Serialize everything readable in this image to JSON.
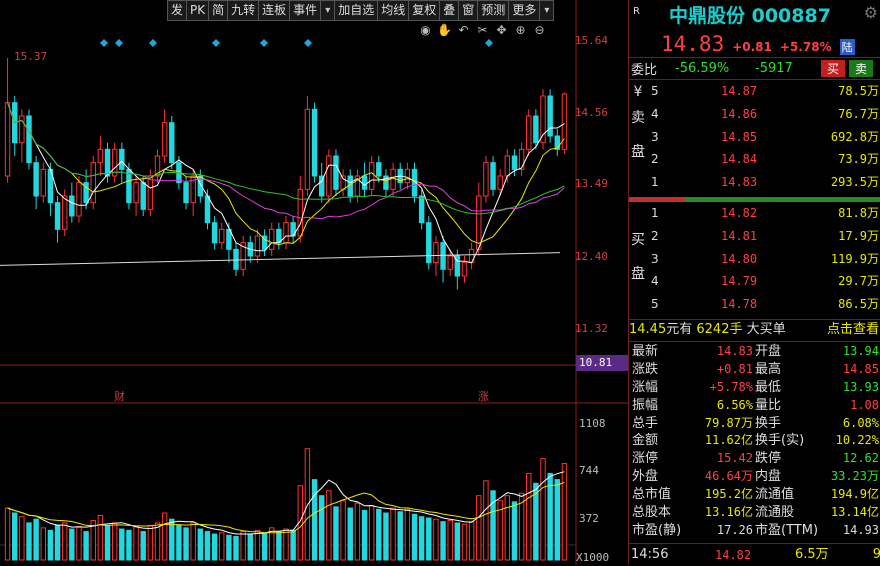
{
  "toolbar": [
    "发",
    "PK",
    "简",
    "九转",
    "连板",
    "事件",
    "▾",
    "加自选",
    "均线",
    "复权",
    "叠",
    "窗",
    "预测",
    "更多",
    "▾"
  ],
  "chart": {
    "high_marker": "15.37",
    "price_axis": [
      "15.64",
      "14.56",
      "13.49",
      "12.40",
      "11.32"
    ],
    "current_price_tag": "10.81",
    "volume_axis": [
      "1108",
      "744",
      "372"
    ],
    "volume_unit": "X1000",
    "event_labels": [
      "财",
      "涨"
    ],
    "colors": {
      "up": "#ff3232",
      "down": "#22d8e0",
      "ma5": "#ffffff",
      "ma10": "#e8e800",
      "ma20": "#e040e0",
      "ma60": "#30c030",
      "ma250": "#dddddd"
    }
  },
  "chart_data": {
    "type": "candlestick",
    "candles": [
      [
        13.6,
        14.7,
        15.37,
        13.5
      ],
      [
        14.7,
        14.1,
        14.8,
        13.9
      ],
      [
        14.1,
        14.5,
        14.6,
        13.8
      ],
      [
        14.5,
        13.8,
        14.6,
        13.7
      ],
      [
        13.8,
        13.3,
        13.9,
        13.1
      ],
      [
        13.3,
        13.7,
        13.8,
        13.2
      ],
      [
        13.7,
        13.2,
        13.8,
        13.0
      ],
      [
        13.2,
        12.8,
        13.3,
        12.6
      ],
      [
        12.8,
        13.3,
        13.4,
        12.7
      ],
      [
        13.3,
        13.0,
        13.5,
        12.9
      ],
      [
        13.0,
        13.5,
        13.6,
        12.9
      ],
      [
        13.5,
        13.2,
        13.7,
        13.1
      ],
      [
        13.2,
        13.8,
        13.9,
        13.1
      ],
      [
        13.8,
        14.0,
        14.2,
        13.6
      ],
      [
        14.0,
        13.6,
        14.1,
        13.5
      ],
      [
        13.6,
        14.0,
        14.1,
        13.5
      ],
      [
        14.0,
        13.7,
        14.1,
        13.5
      ],
      [
        13.7,
        13.2,
        13.8,
        13.1
      ],
      [
        13.2,
        13.5,
        13.6,
        13.0
      ],
      [
        13.5,
        13.1,
        13.6,
        13.0
      ],
      [
        13.1,
        13.6,
        13.7,
        13.0
      ],
      [
        13.6,
        13.9,
        14.0,
        13.5
      ],
      [
        13.9,
        14.4,
        14.6,
        13.8
      ],
      [
        14.4,
        13.8,
        14.5,
        13.7
      ],
      [
        13.8,
        13.5,
        13.9,
        13.4
      ],
      [
        13.5,
        13.2,
        13.6,
        13.1
      ],
      [
        13.2,
        13.6,
        13.7,
        13.0
      ],
      [
        13.6,
        13.3,
        13.7,
        13.2
      ],
      [
        13.3,
        12.9,
        13.4,
        12.8
      ],
      [
        12.9,
        12.6,
        13.0,
        12.5
      ],
      [
        12.6,
        12.8,
        12.9,
        12.5
      ],
      [
        12.8,
        12.5,
        12.9,
        12.3
      ],
      [
        12.5,
        12.2,
        12.6,
        12.1
      ],
      [
        12.2,
        12.6,
        12.7,
        12.1
      ],
      [
        12.6,
        12.4,
        12.7,
        12.3
      ],
      [
        12.4,
        12.7,
        12.8,
        12.3
      ],
      [
        12.7,
        12.5,
        12.8,
        12.4
      ],
      [
        12.5,
        12.8,
        12.9,
        12.4
      ],
      [
        12.8,
        12.6,
        12.9,
        12.5
      ],
      [
        12.6,
        12.9,
        13.0,
        12.5
      ],
      [
        12.9,
        12.7,
        13.0,
        12.6
      ],
      [
        12.7,
        13.4,
        13.6,
        12.6
      ],
      [
        13.4,
        14.6,
        14.8,
        13.3
      ],
      [
        14.6,
        13.6,
        14.7,
        13.5
      ],
      [
        13.6,
        13.3,
        13.8,
        13.2
      ],
      [
        13.3,
        13.9,
        14.0,
        13.2
      ],
      [
        13.9,
        13.4,
        14.0,
        13.3
      ],
      [
        13.4,
        13.6,
        13.7,
        13.3
      ],
      [
        13.6,
        13.3,
        13.7,
        13.2
      ],
      [
        13.3,
        13.6,
        13.7,
        13.2
      ],
      [
        13.6,
        13.4,
        13.8,
        13.3
      ],
      [
        13.4,
        13.8,
        13.9,
        13.3
      ],
      [
        13.8,
        13.6,
        13.9,
        13.5
      ],
      [
        13.6,
        13.4,
        13.7,
        13.3
      ],
      [
        13.4,
        13.7,
        13.8,
        13.3
      ],
      [
        13.7,
        13.5,
        13.8,
        13.4
      ],
      [
        13.5,
        13.7,
        13.8,
        13.4
      ],
      [
        13.7,
        13.3,
        13.8,
        13.2
      ],
      [
        13.3,
        12.9,
        13.4,
        12.8
      ],
      [
        12.9,
        12.3,
        13.0,
        12.2
      ],
      [
        12.3,
        12.6,
        12.7,
        12.1
      ],
      [
        12.6,
        12.2,
        12.7,
        12.0
      ],
      [
        12.2,
        12.4,
        12.5,
        12.1
      ],
      [
        12.4,
        12.1,
        12.5,
        11.9
      ],
      [
        12.1,
        12.3,
        12.4,
        12.0
      ],
      [
        12.3,
        12.5,
        12.6,
        12.2
      ],
      [
        12.5,
        13.3,
        13.5,
        12.4
      ],
      [
        13.3,
        13.8,
        13.9,
        13.2
      ],
      [
        13.8,
        13.4,
        13.9,
        13.3
      ],
      [
        13.4,
        13.6,
        13.7,
        13.3
      ],
      [
        13.6,
        13.9,
        14.0,
        13.5
      ],
      [
        13.9,
        13.7,
        14.0,
        13.6
      ],
      [
        13.7,
        14.0,
        14.1,
        13.6
      ],
      [
        14.0,
        14.5,
        14.6,
        13.9
      ],
      [
        14.5,
        14.1,
        14.6,
        14.0
      ],
      [
        14.1,
        14.8,
        14.9,
        14.0
      ],
      [
        14.8,
        14.2,
        14.9,
        14.1
      ],
      [
        14.2,
        14.0,
        14.3,
        13.9
      ],
      [
        14.0,
        14.83,
        14.85,
        13.93
      ]
    ],
    "volumes": [
      420,
      380,
      350,
      300,
      330,
      260,
      240,
      280,
      300,
      250,
      270,
      230,
      320,
      360,
      280,
      300,
      250,
      240,
      270,
      230,
      280,
      300,
      380,
      330,
      280,
      260,
      300,
      250,
      230,
      210,
      220,
      200,
      190,
      230,
      210,
      240,
      220,
      260,
      230,
      250,
      240,
      600,
      900,
      650,
      520,
      560,
      430,
      480,
      420,
      460,
      400,
      440,
      410,
      380,
      420,
      390,
      410,
      370,
      350,
      340,
      330,
      310,
      320,
      300,
      290,
      310,
      520,
      640,
      560,
      480,
      520,
      470,
      540,
      700,
      620,
      820,
      700,
      650,
      780
    ],
    "ylim_price": [
      10.81,
      15.64
    ],
    "ylim_volume": [
      0,
      1108
    ]
  },
  "panel": {
    "corner_label": "R",
    "stock_name": "中鼎股份 000887",
    "price": "14.83",
    "change": "+0.81",
    "change_pct": "+5.78%",
    "badge": "陆",
    "weibi_label": "委比",
    "weibi_value": "-56.59%",
    "weicha_value": "-5917",
    "sell_btn": "买",
    "buy_btn": "卖",
    "sell_side_label": "¥ 卖 盘",
    "buy_side_label": "买 盘",
    "asks": [
      {
        "lv": "5",
        "price": "14.87",
        "vol": "78.5万"
      },
      {
        "lv": "4",
        "price": "14.86",
        "vol": "76.7万"
      },
      {
        "lv": "3",
        "price": "14.85",
        "vol": "692.8万"
      },
      {
        "lv": "2",
        "price": "14.84",
        "vol": "73.9万"
      },
      {
        "lv": "1",
        "price": "14.83",
        "vol": "293.5万"
      }
    ],
    "bids": [
      {
        "lv": "1",
        "price": "14.82",
        "vol": "81.8万"
      },
      {
        "lv": "2",
        "price": "14.81",
        "vol": "17.9万"
      },
      {
        "lv": "3",
        "price": "14.80",
        "vol": "119.9万"
      },
      {
        "lv": "4",
        "price": "14.79",
        "vol": "29.7万"
      },
      {
        "lv": "5",
        "price": "14.78",
        "vol": "86.5万"
      }
    ],
    "big_order": {
      "price": "14.45",
      "unit": "元有",
      "qty": "6242手",
      "label": "大买单",
      "link": "点击查看"
    },
    "stats": [
      {
        "l1": "最新",
        "v1": "14.83",
        "c1": "red",
        "l2": "开盘",
        "v2": "13.94",
        "c2": "green"
      },
      {
        "l1": "涨跌",
        "v1": "+0.81",
        "c1": "red",
        "l2": "最高",
        "v2": "14.85",
        "c2": "red"
      },
      {
        "l1": "涨幅",
        "v1": "+5.78%",
        "c1": "red",
        "l2": "最低",
        "v2": "13.93",
        "c2": "green"
      },
      {
        "l1": "振幅",
        "v1": "6.56%",
        "c1": "yellow",
        "l2": "量比",
        "v2": "1.08",
        "c2": "red"
      },
      {
        "l1": "总手",
        "v1": "79.87万",
        "c1": "yellow",
        "l2": "换手",
        "v2": "6.08%",
        "c2": "yellow"
      },
      {
        "l1": "金额",
        "v1": "11.62亿",
        "c1": "yellow",
        "l2": "换手(实)",
        "v2": "10.22%",
        "c2": "yellow"
      },
      {
        "l1": "涨停",
        "v1": "15.42",
        "c1": "red",
        "l2": "跌停",
        "v2": "12.62",
        "c2": "green"
      },
      {
        "l1": "外盘",
        "v1": "46.64万",
        "c1": "red",
        "l2": "内盘",
        "v2": "33.23万",
        "c2": "green"
      },
      {
        "l1": "总市值",
        "v1": "195.2亿",
        "c1": "yellow",
        "l2": "流通值",
        "v2": "194.9亿",
        "c2": "yellow"
      },
      {
        "l1": "总股本",
        "v1": "13.16亿",
        "c1": "yellow",
        "l2": "流通股",
        "v2": "13.14亿",
        "c2": "yellow"
      },
      {
        "l1": "市盈(静)",
        "v1": "17.26",
        "c1": "white",
        "l2": "市盈(TTM)",
        "v2": "14.93",
        "c2": "white"
      }
    ],
    "tick": {
      "time": "14:56",
      "price": "14.82",
      "vol": "6.5万",
      "count": "9"
    }
  }
}
